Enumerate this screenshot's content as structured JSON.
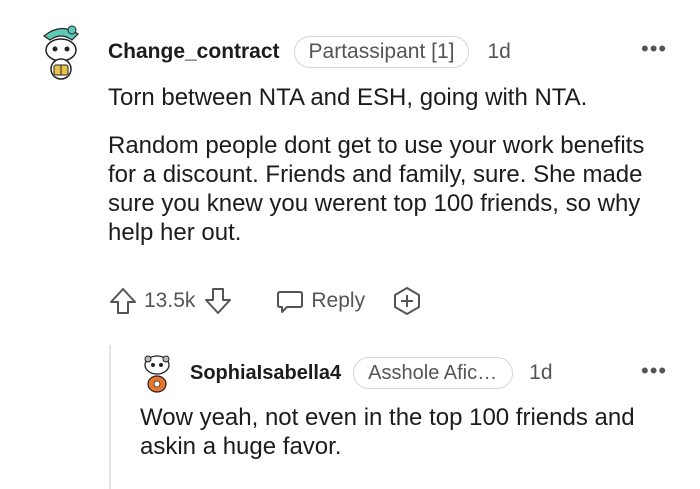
{
  "comments": [
    {
      "username": "Change_contract",
      "flair": "Partassipant [1]",
      "time": "1d",
      "paragraphs": [
        "Torn between NTA and ESH, going with NTA.",
        "Random people dont get to use your work benefits for a discount. Friends and family, sure. She made sure you knew you werent top 100 friends, so why help her out."
      ],
      "votes": "13.5k",
      "reply_label": "Reply",
      "icons": [
        "upvote-icon",
        "downvote-icon",
        "chat-bubble-icon",
        "award-icon",
        "more-icon"
      ]
    },
    {
      "username": "SophiaIsabella4",
      "flair": "Asshole Aficio...",
      "time": "1d",
      "paragraphs": [
        "Wow yeah, not even in the top 100 friends and askin a huge favor."
      ]
    }
  ],
  "colors": {
    "text": "#1c1c1c",
    "muted": "#555555",
    "border": "#d6d6d6",
    "thread": "#e4e4e4",
    "avatar_teal": "#5fc9b8",
    "avatar_orange": "#e8772e"
  }
}
